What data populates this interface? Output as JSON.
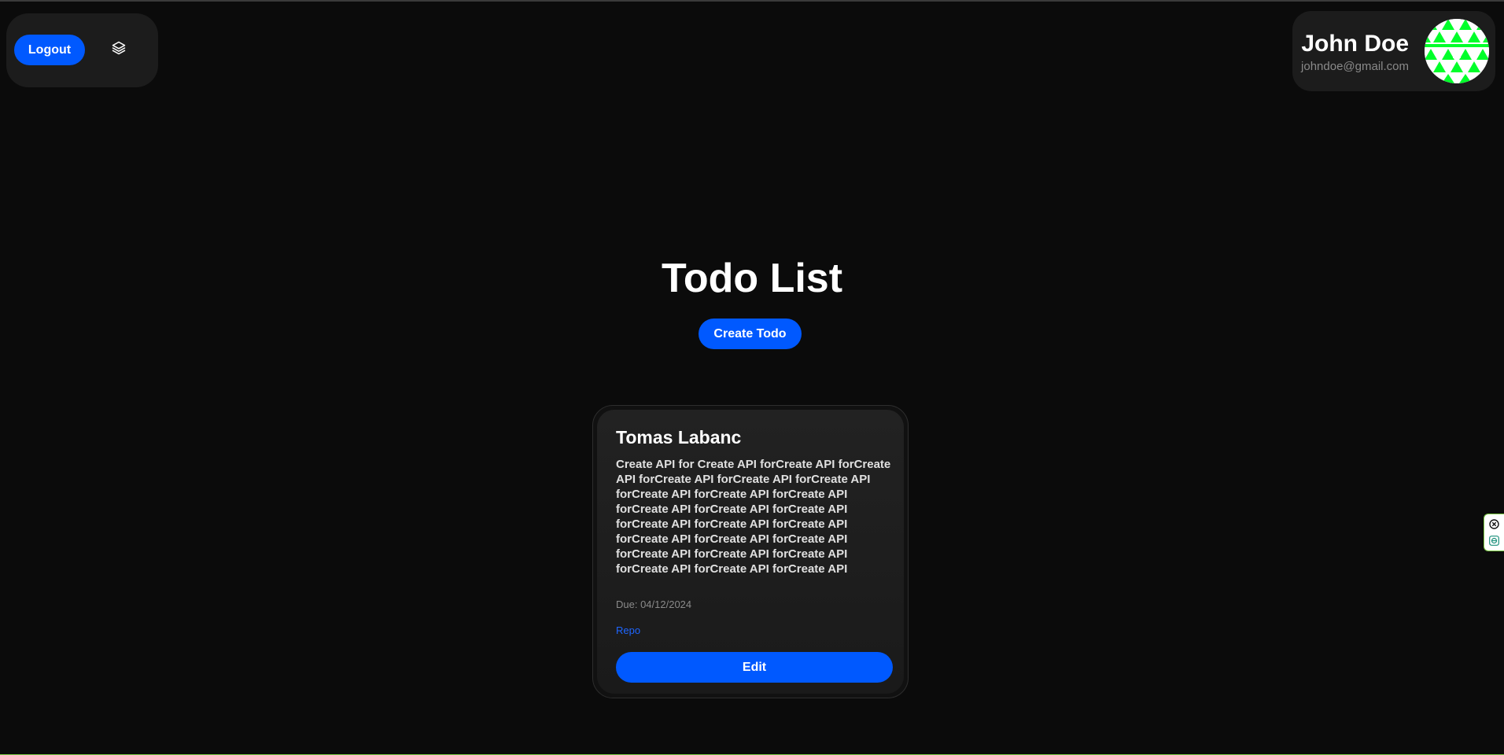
{
  "header": {
    "logout_label": "Logout",
    "layers_icon": "layers-icon"
  },
  "user": {
    "name": "John Doe",
    "email": "johndoe@gmail.com",
    "avatar_colors": [
      "#00ff2a",
      "#ffffff"
    ]
  },
  "main": {
    "title": "Todo List",
    "create_label": "Create Todo"
  },
  "todos": [
    {
      "title": "Tomas Labanc",
      "description": "Create API for Create API forCreate API forCreate API forCreate API forCreate API forCreate API forCreate API forCreate API forCreate API forCreate API forCreate API forCreate API forCreate API forCreate API forCreate API forCreate API forCreate API forCreate API forCreate API forCreate API forCreate API forCreate API forCreate API forCreate API forCreate API forCreate API forCreate API for",
      "due": "Due: 04/12/2024",
      "link_label": "Repo",
      "edit_label": "Edit"
    }
  ],
  "extension": {
    "close_icon": "close-icon",
    "logo_icon": "extension-logo-icon"
  },
  "colors": {
    "accent": "#0059ff",
    "background": "#0b0b0b",
    "panel": "#1c1c1c",
    "link": "#1e66ff"
  }
}
